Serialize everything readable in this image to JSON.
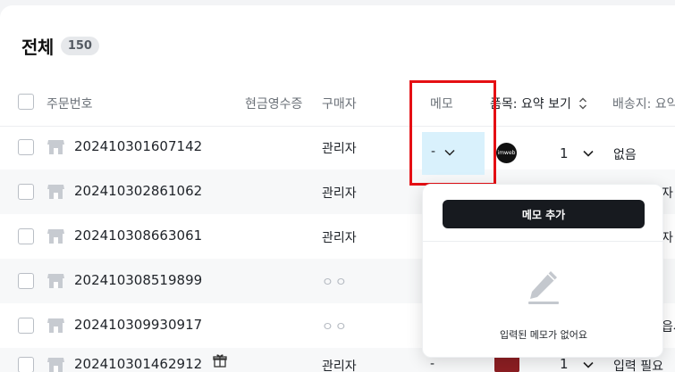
{
  "header": {
    "title": "전체",
    "count": "150"
  },
  "columns": {
    "order_number": "주문번호",
    "cash_receipt": "현금영수증",
    "buyer": "구매자",
    "memo": "메모",
    "product": "품목: 요약 보기",
    "shipping": "배송지: 요약"
  },
  "rows": [
    {
      "order_number": "202410301607142",
      "buyer": "관리자",
      "memo": "-",
      "qty": "1",
      "shipping": "없음"
    },
    {
      "order_number": "202410302861062",
      "buyer": "관리자",
      "right_text": "자"
    },
    {
      "order_number": "202410308663061",
      "buyer": "관리자",
      "right_text": "자"
    },
    {
      "order_number": "202410308519899",
      "buyer": "ㅇㅇ",
      "right_text": ""
    },
    {
      "order_number": "202410309930917",
      "buyer": "ㅇㅇ",
      "right_text": "읍시"
    },
    {
      "order_number": "202410301462912",
      "buyer": "관리자",
      "memo": "-",
      "qty": "1",
      "shipping": "입력 필요"
    }
  ],
  "brand_logo_text": "imweb",
  "popover": {
    "add_memo_label": "메모 추가",
    "empty_message": "입력된 메모가 없어요"
  },
  "colors": {
    "highlight_box": "#e50f14",
    "memo_cell_bg": "#d9f1fc",
    "primary_button": "#171a1f"
  }
}
